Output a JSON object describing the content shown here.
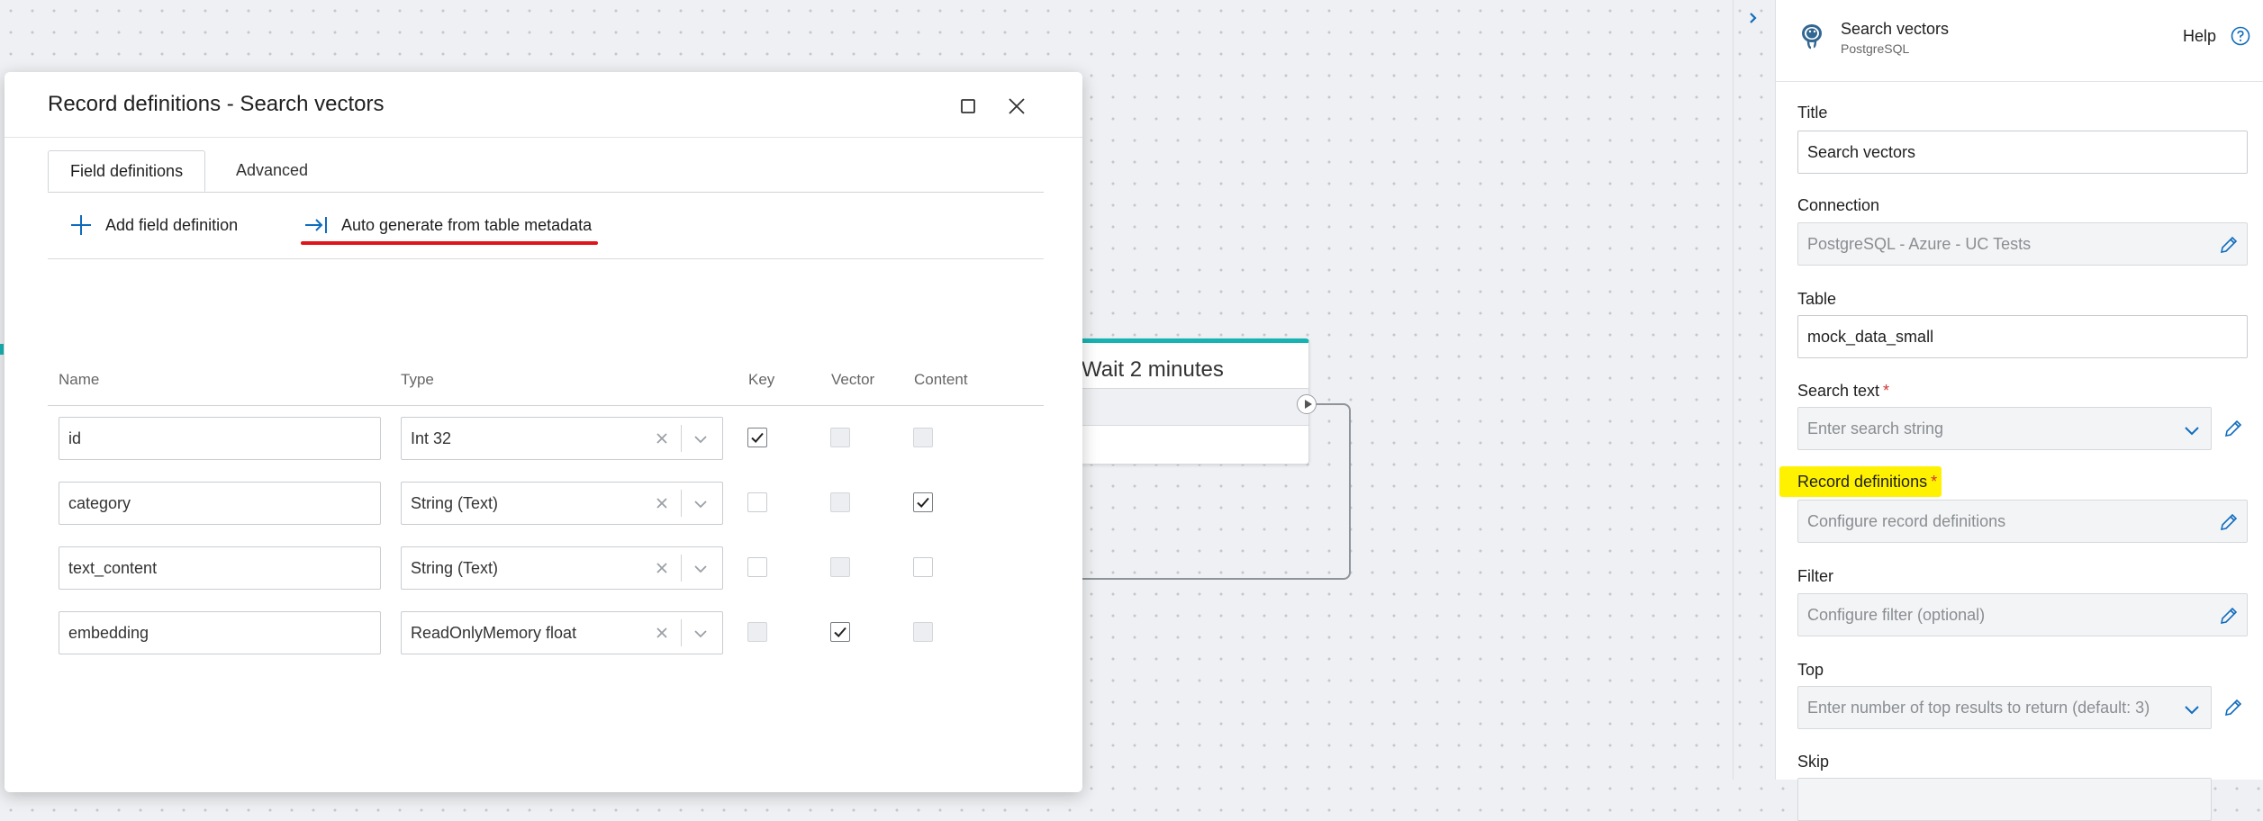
{
  "canvas": {
    "node_title": "Wait 2 minutes"
  },
  "dialog": {
    "title": "Record definitions - Search vectors",
    "tabs": [
      {
        "label": "Field definitions",
        "active": true
      },
      {
        "label": "Advanced",
        "active": false
      }
    ],
    "toolbar": {
      "add_label": "Add field definition",
      "auto_label": "Auto generate from table metadata"
    },
    "columns": {
      "name": "Name",
      "type": "Type",
      "key": "Key",
      "vector": "Vector",
      "content": "Content"
    },
    "rows": [
      {
        "name": "id",
        "type": "Int 32",
        "key": "checked",
        "vector": "disabled",
        "content": "disabled"
      },
      {
        "name": "category",
        "type": "String (Text)",
        "key": "unchecked",
        "vector": "disabled",
        "content": "checked"
      },
      {
        "name": "text_content",
        "type": "String (Text)",
        "key": "unchecked",
        "vector": "disabled",
        "content": "unchecked"
      },
      {
        "name": "embedding",
        "type": "ReadOnlyMemory float",
        "key": "disabled",
        "vector": "checked",
        "content": "disabled"
      }
    ]
  },
  "panel": {
    "title": "Search vectors",
    "subtitle": "PostgreSQL",
    "help": "Help",
    "fields": {
      "title": {
        "label": "Title",
        "value": "Search vectors"
      },
      "connection": {
        "label": "Connection",
        "value": "PostgreSQL - Azure - UC Tests"
      },
      "table": {
        "label": "Table",
        "value": "mock_data_small"
      },
      "search_text": {
        "label": "Search text",
        "required": "*",
        "placeholder": "Enter search string"
      },
      "record_definitions": {
        "label": "Record definitions",
        "required": "*",
        "placeholder": "Configure record definitions"
      },
      "filter": {
        "label": "Filter",
        "placeholder": "Configure filter (optional)"
      },
      "top": {
        "label": "Top",
        "placeholder": "Enter number of top results to return (default: 3)"
      },
      "skip": {
        "label": "Skip"
      }
    }
  },
  "colors": {
    "accent": "#0f6cbd",
    "node_accent": "#17b3b3",
    "highlight": "#fff200",
    "underline": "#e0141b",
    "required": "#d13438"
  }
}
